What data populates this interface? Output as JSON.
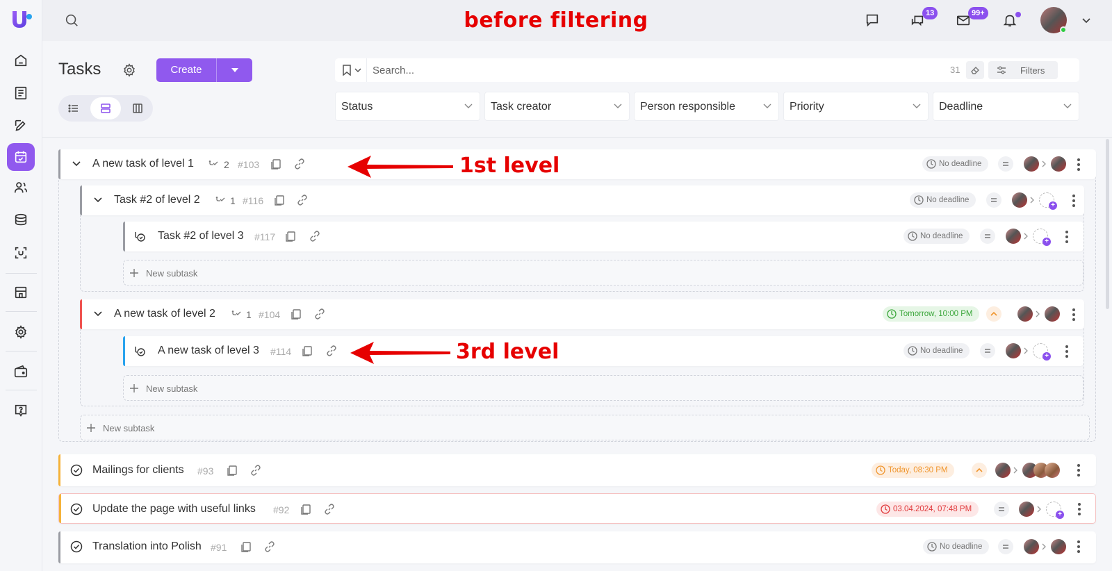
{
  "annotations": {
    "banner": "before filtering",
    "first_level": "1st level",
    "third_level": "3rd level"
  },
  "sidebar": {
    "items": [
      {
        "icon": "home-icon"
      },
      {
        "icon": "document-icon"
      },
      {
        "icon": "pen-icon"
      },
      {
        "icon": "calendar-check-icon",
        "active": true
      },
      {
        "icon": "users-icon"
      },
      {
        "icon": "database-icon"
      },
      {
        "icon": "scan-icon"
      },
      {
        "icon": "store-icon"
      },
      {
        "icon": "gear-icon"
      },
      {
        "icon": "wallet-icon"
      },
      {
        "icon": "help-icon"
      }
    ]
  },
  "topbar": {
    "chat_badge": "13",
    "mail_badge": "99+"
  },
  "page": {
    "title": "Tasks",
    "create_label": "Create",
    "search_placeholder": "Search...",
    "result_count": "31",
    "filters_label": "Filters"
  },
  "filters": [
    "Status",
    "Task creator",
    "Person responsible",
    "Priority",
    "Deadline"
  ],
  "tasks": [
    {
      "title": "A new task of level 1",
      "subtasks": "2",
      "id": "#103",
      "deadline": "No deadline",
      "deadline_style": "gray",
      "priority": "normal"
    },
    {
      "title": "Task #2 of level 2",
      "subtasks": "1",
      "id": "#116",
      "deadline": "No deadline",
      "deadline_style": "gray",
      "priority": "normal"
    },
    {
      "title": "Task #2 of level 3",
      "id": "#117",
      "deadline": "No deadline",
      "deadline_style": "gray",
      "priority": "normal"
    },
    {
      "title": "A new task of level 2",
      "subtasks": "1",
      "id": "#104",
      "deadline": "Tomorrow, 10:00 PM",
      "deadline_style": "green",
      "priority": "high"
    },
    {
      "title": "A new task of level 3",
      "id": "#114",
      "deadline": "No deadline",
      "deadline_style": "gray",
      "priority": "normal"
    },
    {
      "title": "Mailings for clients",
      "id": "#93",
      "deadline": "Today, 08:30 PM",
      "deadline_style": "orange",
      "priority": "high"
    },
    {
      "title": "Update the page with useful links",
      "id": "#92",
      "deadline": "03.04.2024, 07:48 PM",
      "deadline_style": "red",
      "priority": "normal"
    },
    {
      "title": "Translation into Polish",
      "id": "#91",
      "deadline": "No deadline",
      "deadline_style": "gray",
      "priority": "normal"
    }
  ],
  "new_subtask_label": "New subtask",
  "colors": {
    "accent": "#9059ee",
    "annotation": "#e60000",
    "bar_gray": "#9a9ca3",
    "bar_red": "#ef5350",
    "bar_blue": "#29a3ee",
    "bar_orange": "#f5b23a"
  }
}
